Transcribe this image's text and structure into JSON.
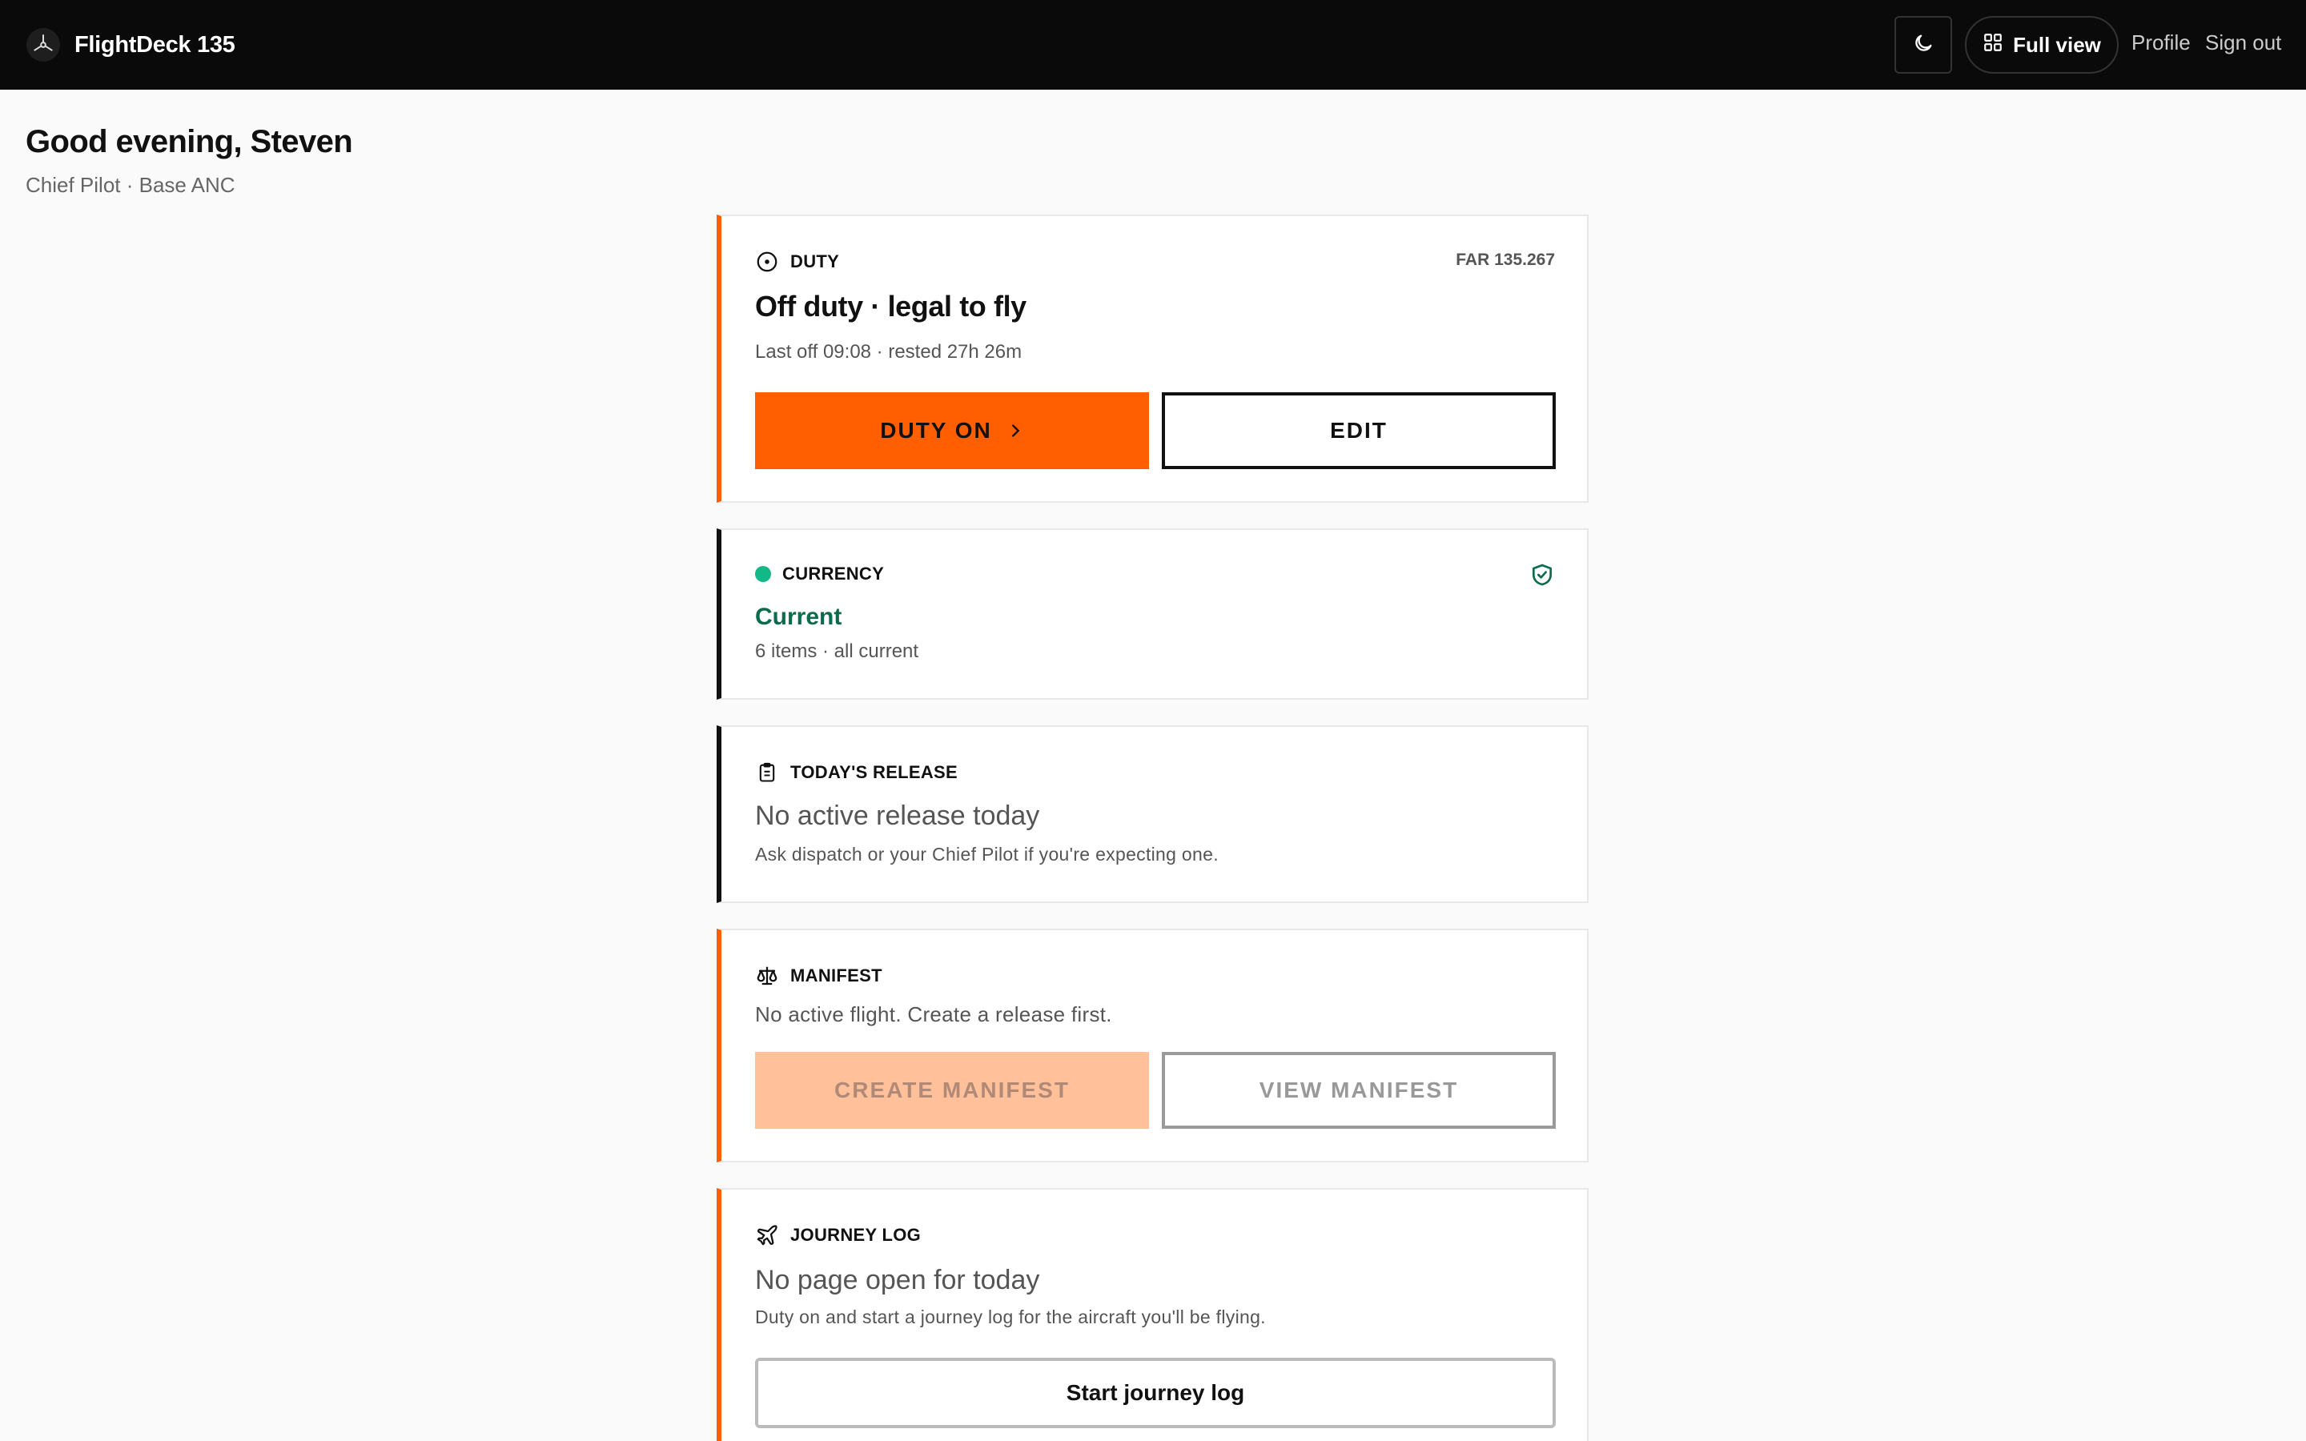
{
  "app": {
    "name": "FlightDeck 135"
  },
  "header": {
    "theme_icon": "moon-icon",
    "full_view_label": "Full view",
    "full_view_icon": "grid-icon",
    "profile_label": "Profile",
    "signout_label": "Sign out"
  },
  "greeting": {
    "title": "Good evening, Steven",
    "subtitle": "Chief Pilot · Base ANC"
  },
  "duty": {
    "label": "DUTY",
    "reg": "FAR 135.267",
    "status": "Off duty · legal to fly",
    "detail": "Last off 09:08 · rested 27h 26m",
    "primary_button": "DUTY ON",
    "secondary_button": "EDIT",
    "accent": "#ff5f00"
  },
  "currency": {
    "label": "CURRENCY",
    "status": "Current",
    "detail": "6 items · all current",
    "status_color": "#0b6b4a",
    "dot_color": "#12b886"
  },
  "release": {
    "label": "TODAY'S RELEASE",
    "title": "No active release today",
    "detail": "Ask dispatch or your Chief Pilot if you're expecting one."
  },
  "manifest": {
    "label": "MANIFEST",
    "detail": "No active flight. Create a release first.",
    "create_button": "CREATE MANIFEST",
    "view_button": "VIEW MANIFEST"
  },
  "journey": {
    "label": "JOURNEY LOG",
    "title": "No page open for today",
    "detail": "Duty on and start a journey log for the aircraft you'll be flying.",
    "button": "Start journey log"
  }
}
